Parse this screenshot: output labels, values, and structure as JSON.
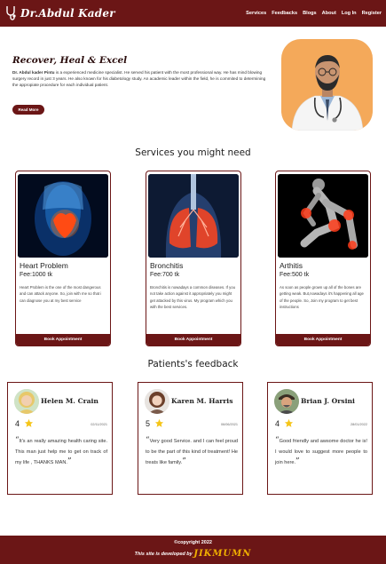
{
  "navbar": {
    "brand": "Dr.Abdul Kader",
    "menu": [
      "Services",
      "Feedbacks",
      "Blogs",
      "About",
      "Log In",
      "Register"
    ]
  },
  "hero": {
    "title": "Recover, Heal & Excel",
    "name": "Dr. Abdul kader Pintu",
    "description": " is a experienced medicine specialist. He served his patient with the most professional way. He has mind blowing surgery record in just 3 years. He also known for his diabetology study. An academic leader within the field, he is commited to determining the appropiate procedure for each individual patient.",
    "button": "Read More"
  },
  "services": {
    "title": "Services you might need",
    "items": [
      {
        "name": "Heart Problem",
        "fee": "Fee:1000 tk",
        "description": "Heart Problem is the one of the most dangerous and can attack anyone. So, join with me so that i can diagnose you at my best service",
        "button": "Book Appointment"
      },
      {
        "name": "Bronchitis",
        "fee": "Fee:700 tk",
        "description": "Bronchitis is nowadays a common diseases. If you not take action against it appropriately you might get attacked by this virus. My program which you with the best services.",
        "button": "Book Appointment"
      },
      {
        "name": "Arthitis",
        "fee": "Fee:500 tk",
        "description": "As soon as people grown up all of the bones are getting weak. But,nowadays it's happening all age of the people. So, Join my program to get best instructions",
        "button": "Book Appointment"
      }
    ]
  },
  "feedback": {
    "title": "Patients's feedback",
    "items": [
      {
        "name": "Helen M. Crain",
        "rating": "4",
        "date": "02/11/2021",
        "text": "It's an really amazing health caring site. This man just help me to get on track of my life , THANKS MAN."
      },
      {
        "name": "Karen M. Harris",
        "rating": "5",
        "date": "06/06/2021",
        "text": "Very good Service. and I can feel proud to be the part of this kind of treatment! He treats like family."
      },
      {
        "name": "Brian J. Orsini",
        "rating": "4",
        "date": "28/01/2022",
        "text": "Good friendly and awsome doctor he is! I would love to suggest more people to join here."
      }
    ]
  },
  "footer": {
    "copyright": "©copyright 2022",
    "developed_by": "This site is developed by",
    "signature": "JIKMUMN"
  },
  "colors": {
    "primary": "#6b1616",
    "hero_photo_bg": "#f4a95a",
    "star": "#f5c518"
  }
}
